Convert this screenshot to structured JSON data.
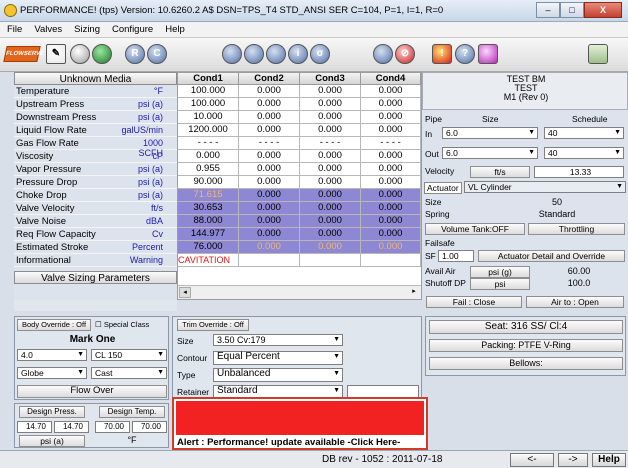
{
  "window": {
    "title": "PERFORMANCE! (tps) Version: 10.6260.2  A$ DSN=TPS_T4 STD_ANSI SER  C=104,  P=1,  I=1,  R=0",
    "buttons": [
      "–",
      "□",
      "X"
    ]
  },
  "menu": [
    "File",
    "Valves",
    "Sizing",
    "Configure",
    "Help"
  ],
  "toolbar": {
    "logo_text": "FLOWSERVE",
    "round_buttons": [
      "",
      "",
      "R",
      "C",
      "",
      "",
      "",
      "",
      "σ",
      "",
      "",
      "!",
      "?",
      ""
    ]
  },
  "left_panel": {
    "header": "Unknown Media",
    "rows": [
      {
        "name": "Temperature",
        "unit": "°F"
      },
      {
        "name": "Upstream Press",
        "unit": "psi (a)"
      },
      {
        "name": "Downstream Press",
        "unit": "psi (a)"
      },
      {
        "name": "Liquid Flow Rate",
        "unit": "galUS/min"
      },
      {
        "name": "Gas Flow Rate",
        "unit": "1000 SCFH"
      },
      {
        "name": "Viscosity",
        "unit": "cP"
      },
      {
        "name": "Vapor Pressure",
        "unit": "psi (a)"
      },
      {
        "name": "Pressure Drop",
        "unit": "psi (a)"
      },
      {
        "name": "Choke Drop",
        "unit": "psi (a)"
      },
      {
        "name": "Valve Velocity",
        "unit": "ft/s"
      },
      {
        "name": "Valve Noise",
        "unit": "dBA"
      },
      {
        "name": "Req Flow Capacity",
        "unit": "Cv"
      },
      {
        "name": "Estimated Stroke",
        "unit": "Percent"
      },
      {
        "name": "Informational",
        "unit": "Warning"
      }
    ],
    "footer_button": "Valve Sizing Parameters"
  },
  "grid": {
    "columns": [
      "Cond1",
      "Cond2",
      "Cond3",
      "Cond4"
    ],
    "rows": [
      [
        "100.000",
        "0.000",
        "0.000",
        "0.000"
      ],
      [
        "100.000",
        "0.000",
        "0.000",
        "0.000"
      ],
      [
        "10.000",
        "0.000",
        "0.000",
        "0.000"
      ],
      [
        "1200.000",
        "0.000",
        "0.000",
        "0.000"
      ],
      [
        "- - - -",
        "- - - -",
        "- - - -",
        "- - - -"
      ],
      [
        "0.000",
        "0.000",
        "0.000",
        "0.000"
      ],
      [
        "0.955",
        "0.000",
        "0.000",
        "0.000"
      ],
      [
        "90.000",
        "0.000",
        "0.000",
        "0.000"
      ],
      [
        "71.615",
        "0.000",
        "0.000",
        "0.000"
      ],
      [
        "30.653",
        "0.000",
        "0.000",
        "0.000"
      ],
      [
        "88.000",
        "0.000",
        "0.000",
        "0.000"
      ],
      [
        "144.977",
        "0.000",
        "0.000",
        "0.000"
      ],
      [
        "76.000",
        "0.000",
        "0.000",
        "0.000"
      ],
      [
        "CAVITATION",
        "",
        "",
        ""
      ]
    ]
  },
  "right_panel": {
    "model_line1": "TEST BM",
    "model_line2": "TEST",
    "model_line3": "M1  (Rev 0)",
    "pipe_label": "Pipe",
    "size_label": "Size",
    "schedule_label": "Schedule",
    "in_label": "In",
    "in_size": "6.0",
    "in_schedule": "40",
    "out_label": "Out",
    "out_size": "6.0",
    "out_schedule": "40",
    "velocity_label": "Velocity",
    "velocity_unit": "ft/s",
    "velocity_value": "13.33",
    "actuator_label": "Actuator",
    "actuator_value": "VL Cylinder",
    "size2_label": "Size",
    "size2_value": "50",
    "spring_label": "Spring",
    "spring_value": "Standard",
    "volume_tank": "Volume Tank:OFF",
    "throttling": "Throttling",
    "failsafe_label": "Failsafe",
    "sf_label": "SF",
    "sf_value": "1.00",
    "actuator_detail": "Actuator Detail and Override",
    "avail_air_label": "Avail Air",
    "avail_air_unit": "psi (g)",
    "avail_air_value": "60.00",
    "shutoff_label": "Shutoff DP",
    "shutoff_unit": "psi",
    "shutoff_value": "100.0",
    "fail_close": "Fail : Close",
    "air_open": "Air to : Open"
  },
  "bottom": {
    "body_override": "Body Override : Off",
    "special_class": "Special Class",
    "mark": "Mark One",
    "size_sel": "4.0",
    "class_sel": "CL 150",
    "type_sel": "Globe",
    "material_sel": "Cast",
    "flow_over": "Flow Over",
    "design_press": "Design Press.",
    "design_temp": "Design Temp.",
    "press1": "14.70",
    "press2": "14.70",
    "temp1": "70.00",
    "temp2": "70.00",
    "press_unit": "psi (a)",
    "temp_unit": "°F",
    "trim_override": "Trim Override : Off",
    "trim_size_label": "Size",
    "trim_size_value": "3.50 Cv:179",
    "contour_label": "Contour",
    "contour_value": "Equal Percent",
    "type_label": "Type",
    "type_value": "Unbalanced",
    "retainer_label": "Retainer",
    "retainer_value": "Standard",
    "seat": "Seat: 316 SS/ Cl:4",
    "packing": "Packing: PTFE V-Ring",
    "bellows": "Bellows:",
    "alert": "Alert : Performance! update available -Click Here-"
  },
  "status": {
    "db_rev": "DB rev - 1052 : 2011-07-18",
    "back": "<-",
    "forward": "->",
    "help": "Help"
  }
}
